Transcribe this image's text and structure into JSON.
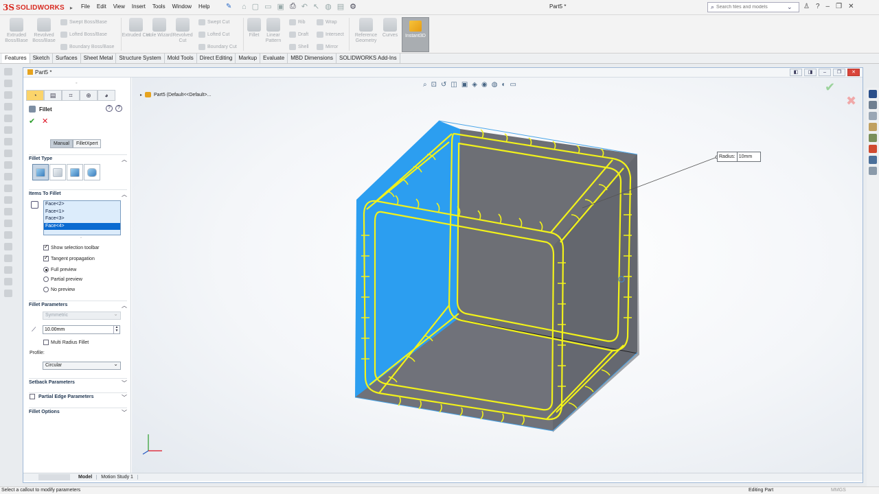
{
  "app": {
    "brand_ds": "3S",
    "brand_name": "SOLIDWORKS",
    "document_title": "Part5 *"
  },
  "menu": [
    "File",
    "Edit",
    "View",
    "Insert",
    "Tools",
    "Window",
    "Help"
  ],
  "search": {
    "placeholder": "Search files and models"
  },
  "ribbon": {
    "extruded_boss": "Extruded Boss/Base",
    "revolved_boss": "Revolved Boss/Base",
    "swept_boss": "Swept Boss/Base",
    "lofted_boss": "Lofted Boss/Base",
    "boundary_boss": "Boundary Boss/Base",
    "extruded_cut": "Extruded Cut",
    "hole_wizard": "Hole Wizard",
    "revolved_cut": "Revolved Cut",
    "swept_cut": "Swept Cut",
    "lofted_cut": "Lofted Cut",
    "boundary_cut": "Boundary Cut",
    "fillet": "Fillet",
    "linear_pattern": "Linear Pattern",
    "rib": "Rib",
    "draft": "Draft",
    "shell": "Shell",
    "wrap": "Wrap",
    "intersect": "Intersect",
    "mirror": "Mirror",
    "reference_geometry": "Reference Geometry",
    "curves": "Curves",
    "instant3d": "Instant3D"
  },
  "tabs": [
    "Features",
    "Sketch",
    "Surfaces",
    "Sheet Metal",
    "Structure System",
    "Mold Tools",
    "Direct Editing",
    "Markup",
    "Evaluate",
    "MBD Dimensions",
    "SOLIDWORKS Add-Ins"
  ],
  "doc_window": {
    "title": "Part5 *"
  },
  "property_manager": {
    "title": "Fillet",
    "mode_manual": "Manual",
    "mode_filletxpert": "FilletXpert",
    "fillet_type_label": "Fillet Type",
    "items_label": "Items To Fillet",
    "items": [
      "Face<2>",
      "Face<1>",
      "Face<3>",
      "Face<4>"
    ],
    "selected_item": 3,
    "show_selection_toolbar": "Show selection toolbar",
    "tangent_propagation": "Tangent propagation",
    "full_preview": "Full preview",
    "partial_preview": "Partial preview",
    "no_preview": "No preview",
    "params_label": "Fillet Parameters",
    "symmetric": "Symmetric",
    "radius_value": "10.00mm",
    "multi_radius": "Multi Radius Fillet",
    "profile_label": "Profile:",
    "profile_value": "Circular",
    "setback_label": "Setback Parameters",
    "partial_edge_label": "Partial Edge Parameters",
    "options_label": "Fillet Options"
  },
  "viewport": {
    "tree_text": "Part5  (Default<<Default>...",
    "callout_label": "Radius:",
    "callout_value": "10mm"
  },
  "bottom_tabs": [
    "Model",
    "Motion Study 1"
  ],
  "status": {
    "left": "Select a callout to modify parameters",
    "mode": "Editing Part",
    "units": "MMGS"
  },
  "colors": {
    "accent": "#0b6bd1",
    "cube_face_blue": "#2c9ef0",
    "cube_face_gray": "#6d6f75",
    "fillet_preview": "#f2f21a",
    "brand_red": "#d82a20"
  }
}
